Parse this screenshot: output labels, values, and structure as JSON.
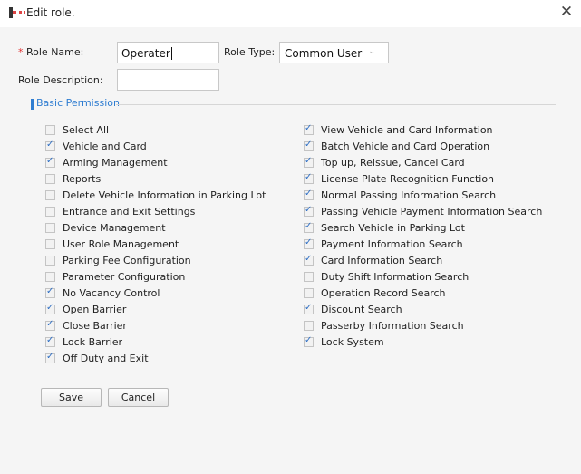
{
  "dialog": {
    "title": "Edit role."
  },
  "form": {
    "required_mark": "*",
    "role_name_label": "Role Name:",
    "role_name_value": "Operater",
    "role_type_label": "Role Type:",
    "role_type_value": "Common User",
    "role_description_label": "Role Description:",
    "role_description_value": ""
  },
  "section": {
    "title": "Basic Permission"
  },
  "permissions_left": [
    {
      "label": "Select All",
      "checked": false
    },
    {
      "label": "Vehicle and Card",
      "checked": true
    },
    {
      "label": "Arming Management",
      "checked": true
    },
    {
      "label": "Reports",
      "checked": false
    },
    {
      "label": "Delete Vehicle Information in Parking Lot",
      "checked": false
    },
    {
      "label": "Entrance and Exit Settings",
      "checked": false
    },
    {
      "label": "Device Management",
      "checked": false
    },
    {
      "label": "User Role Management",
      "checked": false
    },
    {
      "label": "Parking Fee Configuration",
      "checked": false
    },
    {
      "label": "Parameter Configuration",
      "checked": false
    },
    {
      "label": "No Vacancy Control",
      "checked": true
    },
    {
      "label": "Open Barrier",
      "checked": true
    },
    {
      "label": "Close Barrier",
      "checked": true
    },
    {
      "label": "Lock Barrier",
      "checked": true
    },
    {
      "label": "Off Duty and Exit",
      "checked": true
    }
  ],
  "permissions_right": [
    {
      "label": "View Vehicle and Card Information",
      "checked": true
    },
    {
      "label": "Batch Vehicle and Card Operation",
      "checked": true
    },
    {
      "label": "Top up, Reissue, Cancel Card",
      "checked": true
    },
    {
      "label": "License Plate Recognition Function",
      "checked": true
    },
    {
      "label": "Normal Passing Information Search",
      "checked": true
    },
    {
      "label": "Passing Vehicle Payment Information Search",
      "checked": true
    },
    {
      "label": "Search Vehicle in Parking Lot",
      "checked": true
    },
    {
      "label": "Payment Information Search",
      "checked": true
    },
    {
      "label": "Card Information Search",
      "checked": true
    },
    {
      "label": "Duty Shift Information Search",
      "checked": false
    },
    {
      "label": "Operation Record Search",
      "checked": false
    },
    {
      "label": "Discount Search",
      "checked": true
    },
    {
      "label": "Passerby Information Search",
      "checked": false
    },
    {
      "label": "Lock System",
      "checked": true
    }
  ],
  "buttons": {
    "save": "Save",
    "cancel": "Cancel"
  },
  "close_glyph": "✕",
  "select_arrow_glyph": "⌄",
  "colors": {
    "accent": "#2f7dd1",
    "checkmark": "#2f6fc4",
    "required": "#e03030"
  }
}
